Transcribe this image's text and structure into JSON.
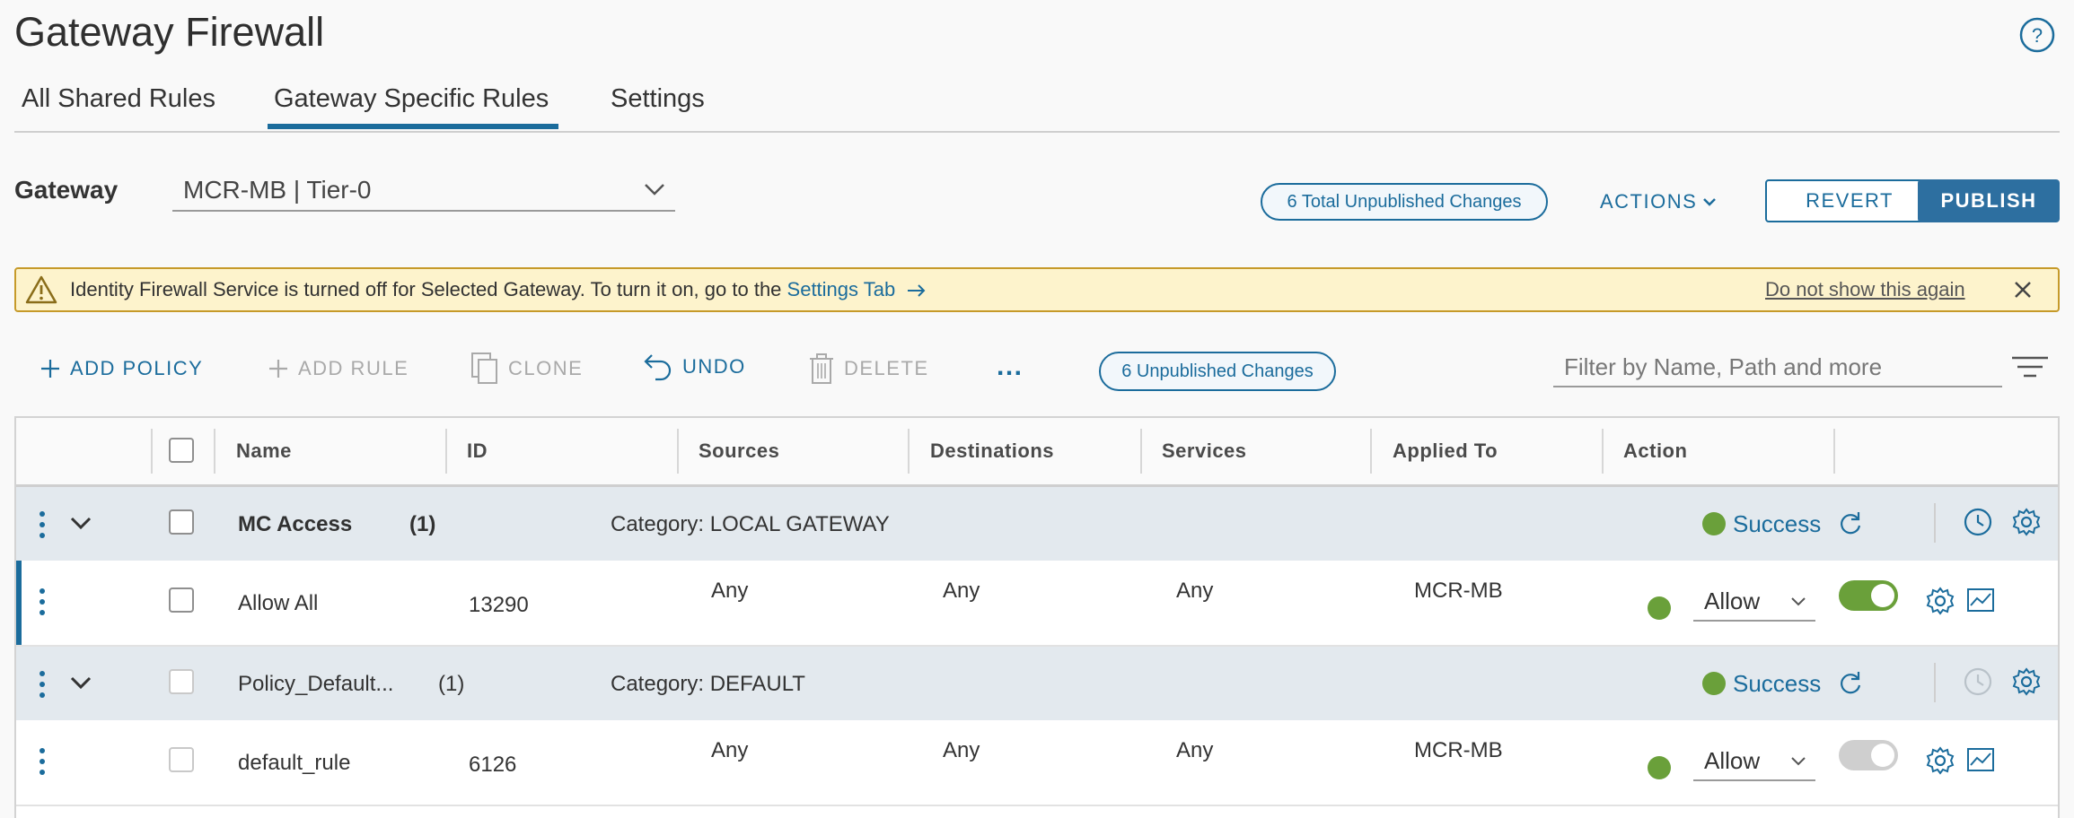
{
  "page": {
    "title": "Gateway Firewall"
  },
  "tabs": [
    {
      "label": "All Shared Rules",
      "active": false
    },
    {
      "label": "Gateway Specific Rules",
      "active": true
    },
    {
      "label": "Settings",
      "active": false
    }
  ],
  "gateway": {
    "label": "Gateway",
    "selected": "MCR-MB | Tier-0"
  },
  "header_actions": {
    "total_changes": "6 Total Unpublished Changes",
    "actions_label": "ACTIONS",
    "revert_label": "REVERT",
    "publish_label": "PUBLISH"
  },
  "banner": {
    "message": "Identity Firewall Service is turned off for Selected Gateway. To turn it on, go to the ",
    "link_text": "Settings Tab",
    "dismiss_text": "Do not show this again"
  },
  "toolbar": {
    "add_policy": "ADD POLICY",
    "add_rule": "ADD RULE",
    "clone": "CLONE",
    "undo": "UNDO",
    "delete": "DELETE",
    "more": "...",
    "unpublished_changes": "6 Unpublished Changes",
    "filter_placeholder": "Filter by Name, Path and more"
  },
  "table": {
    "columns": [
      "Name",
      "ID",
      "Sources",
      "Destinations",
      "Services",
      "Applied To",
      "Action"
    ],
    "policies": [
      {
        "name": "MC Access",
        "count": "(1)",
        "category": "Category: LOCAL GATEWAY",
        "status": "Success",
        "rule": {
          "name": "Allow All",
          "id": "13290",
          "sources": "Any",
          "destinations": "Any",
          "services": "Any",
          "applied_to": "MCR-MB",
          "action": "Allow",
          "enabled": true
        }
      },
      {
        "name": "Policy_Default...",
        "count": "(1)",
        "category": "Category: DEFAULT",
        "status": "Success",
        "rule": {
          "name": "default_rule",
          "id": "6126",
          "sources": "Any",
          "destinations": "Any",
          "services": "Any",
          "applied_to": "MCR-MB",
          "action": "Allow",
          "enabled": false
        }
      }
    ]
  },
  "colors": {
    "accent": "#1b6c9c",
    "success": "#6aa03a",
    "warning_bg": "#fdf3cc",
    "policy_row_bg": "#e3e9ee"
  }
}
